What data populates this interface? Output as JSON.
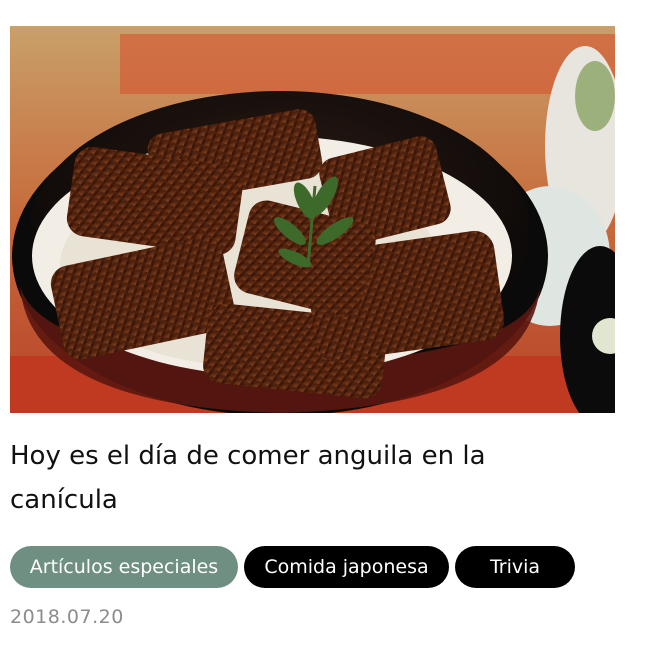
{
  "article": {
    "image_alt": "Unadon: grilled eel over rice in a black lacquer bowl",
    "title": "Hoy es el día de comer anguila en la canícula",
    "tags": [
      {
        "label": "Artículos especiales",
        "color": "#6e8f82"
      },
      {
        "label": "Comida japonesa",
        "color": "#000000"
      },
      {
        "label": "Trivia",
        "color": "#000000"
      }
    ],
    "date": "2018.07.20"
  }
}
